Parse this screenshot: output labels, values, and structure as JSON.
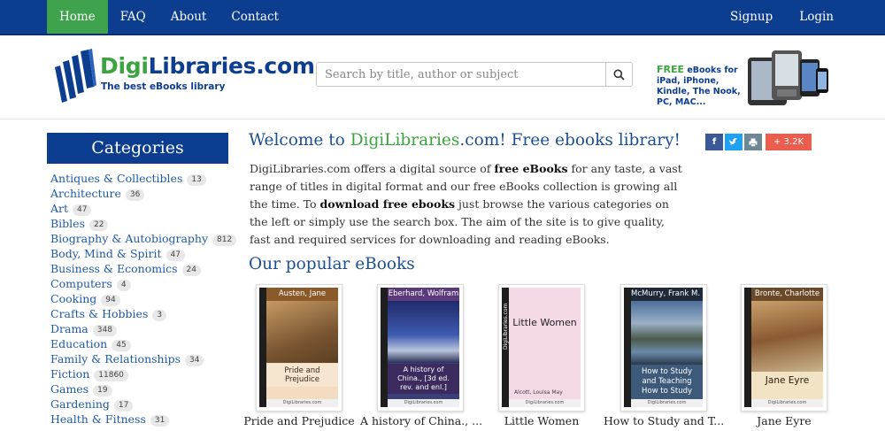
{
  "nav": {
    "left": [
      "Home",
      "FAQ",
      "About",
      "Contact"
    ],
    "right": [
      "Signup",
      "Login"
    ]
  },
  "logo": {
    "brand_green": "Digi",
    "brand_blue": "Libraries.com",
    "tagline": "The best eBooks library"
  },
  "search": {
    "placeholder": "Search by title, author or subject",
    "value": "",
    "icon": "search-icon"
  },
  "promo": {
    "free": "FREE",
    "rest": " eBooks for iPad, iPhone, Kindle, The Nook, PC, MAC..."
  },
  "sidebar": {
    "title": "Categories",
    "items": [
      {
        "label": "Antiques & Collectibles",
        "count": "13"
      },
      {
        "label": "Architecture",
        "count": "36"
      },
      {
        "label": "Art",
        "count": "47"
      },
      {
        "label": "Bibles",
        "count": "22"
      },
      {
        "label": "Biography & Autobiography",
        "count": "812"
      },
      {
        "label": "Body, Mind & Spirit",
        "count": "47"
      },
      {
        "label": "Business & Economics",
        "count": "24"
      },
      {
        "label": "Computers",
        "count": "4"
      },
      {
        "label": "Cooking",
        "count": "94"
      },
      {
        "label": "Crafts & Hobbies",
        "count": "3"
      },
      {
        "label": "Drama",
        "count": "348"
      },
      {
        "label": "Education",
        "count": "45"
      },
      {
        "label": "Family & Relationships",
        "count": "34"
      },
      {
        "label": "Fiction",
        "count": "11860"
      },
      {
        "label": "Games",
        "count": "19"
      },
      {
        "label": "Gardening",
        "count": "17"
      },
      {
        "label": "Health & Fitness",
        "count": "31"
      }
    ]
  },
  "main": {
    "welcome_pre": "Welcome to ",
    "welcome_green": "DigiLibraries",
    "welcome_post": ".com! Free ebooks library!",
    "share_count": "+ 3.2K",
    "intro": {
      "p1": "DigiLibraries.com offers a digital source of ",
      "b1": "free eBooks",
      "p2": " for any taste, a vast range of titles in digital format and our free eBooks collection is growing all the time. To ",
      "b2": "download free ebooks",
      "p3": " just browse the various categories on the left or simply use the search box. The aim of the site is to give quality, fast and required services for downloading and reading eBooks."
    },
    "popular_title": "Our popular eBooks",
    "books": [
      {
        "author": "Austen, Jane",
        "cover_title": "Pride and Prejudice",
        "label": "Pride and Prejudice",
        "bar_color": "#8a5a2b",
        "bg_color": "#f3dcc0"
      },
      {
        "author": "Eberhard, Wolfram",
        "cover_title": "A history of China., [3d ed. rev. and enl.]",
        "label": "A history of China., ...",
        "bar_color": "#5b3a7a",
        "bg_color": "#3a3f7a"
      },
      {
        "author": "Alcott, Louisa May",
        "cover_title": "Little Women",
        "label": "Little Women",
        "bar_color": "#e9d0dc",
        "bg_color": "#f5d9e6"
      },
      {
        "author": "McMurry, Frank M. (Frank Morton)",
        "cover_title": "How to Study and Teaching How to Study",
        "label": "How to Study and T...",
        "bar_color": "#1e2a3a",
        "bg_color": "#3d5a7a"
      },
      {
        "author": "Bronte, Charlotte",
        "cover_title": "Jane Eyre",
        "label": "Jane Eyre",
        "bar_color": "#6a4a28",
        "bg_color": "#f3e3c5"
      }
    ],
    "spine_text": "DigiLibraries.com"
  }
}
